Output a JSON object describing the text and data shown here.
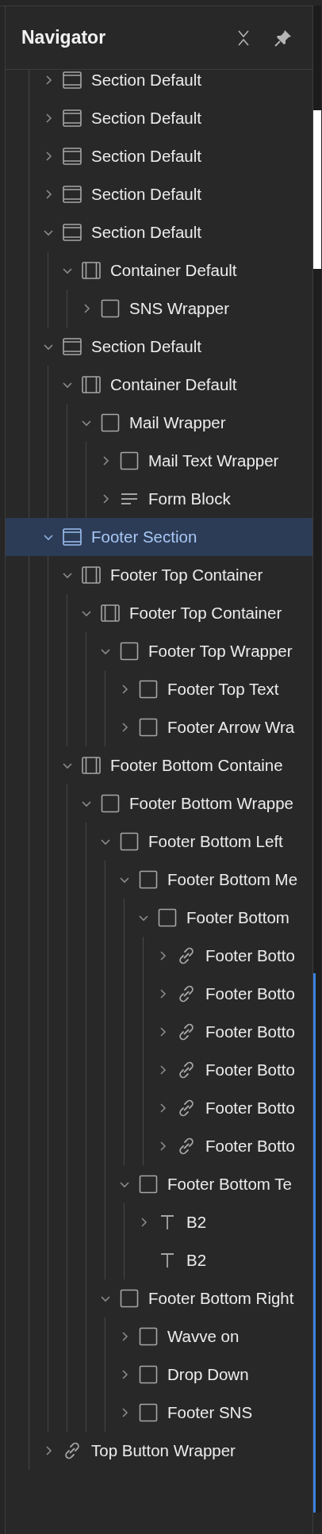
{
  "panel": {
    "title": "Navigator"
  },
  "tree": [
    {
      "label": "Section Default",
      "kind": "section",
      "expanded": false,
      "selected": false
    },
    {
      "label": "Section Default",
      "kind": "section",
      "expanded": false,
      "selected": false
    },
    {
      "label": "Section Default",
      "kind": "section",
      "expanded": false,
      "selected": false
    },
    {
      "label": "Section Default",
      "kind": "section",
      "expanded": false,
      "selected": false
    },
    {
      "label": "Section Default",
      "kind": "section",
      "expanded": true,
      "selected": false,
      "children": [
        {
          "label": "Container Default",
          "kind": "container",
          "expanded": true,
          "selected": false,
          "children": [
            {
              "label": "SNS Wrapper",
              "kind": "div",
              "expanded": false,
              "selected": false
            }
          ]
        }
      ]
    },
    {
      "label": "Section Default",
      "kind": "section",
      "expanded": true,
      "selected": false,
      "children": [
        {
          "label": "Container Default",
          "kind": "container",
          "expanded": true,
          "selected": false,
          "children": [
            {
              "label": "Mail Wrapper",
              "kind": "div",
              "expanded": true,
              "selected": false,
              "children": [
                {
                  "label": "Mail Text Wrapper",
                  "kind": "div",
                  "expanded": false,
                  "selected": false
                },
                {
                  "label": "Form Block",
                  "kind": "form",
                  "expanded": false,
                  "selected": false
                }
              ]
            }
          ]
        }
      ]
    },
    {
      "label": "Footer Section",
      "kind": "section",
      "expanded": true,
      "selected": true,
      "children": [
        {
          "label": "Footer Top Container",
          "kind": "container",
          "expanded": true,
          "selected": false,
          "children": [
            {
              "label": "Footer Top Container",
              "kind": "container",
              "expanded": true,
              "selected": false,
              "children": [
                {
                  "label": "Footer Top Wrapper",
                  "kind": "div",
                  "expanded": true,
                  "selected": false,
                  "children": [
                    {
                      "label": "Footer Top Text",
                      "kind": "div",
                      "expanded": false,
                      "selected": false
                    },
                    {
                      "label": "Footer Arrow Wra",
                      "kind": "div",
                      "expanded": false,
                      "selected": false
                    }
                  ]
                }
              ]
            }
          ]
        },
        {
          "label": "Footer Bottom Containe",
          "kind": "container",
          "expanded": true,
          "selected": false,
          "children": [
            {
              "label": "Footer Bottom Wrappe",
              "kind": "div",
              "expanded": true,
              "selected": false,
              "children": [
                {
                  "label": "Footer Bottom Left",
                  "kind": "div",
                  "expanded": true,
                  "selected": false,
                  "children": [
                    {
                      "label": "Footer Bottom Me",
                      "kind": "div",
                      "expanded": true,
                      "selected": false,
                      "children": [
                        {
                          "label": "Footer Bottom",
                          "kind": "div",
                          "expanded": true,
                          "selected": false,
                          "children": [
                            {
                              "label": "Footer Botto",
                              "kind": "link",
                              "expanded": false,
                              "selected": false
                            },
                            {
                              "label": "Footer Botto",
                              "kind": "link",
                              "expanded": false,
                              "selected": false
                            },
                            {
                              "label": "Footer Botto",
                              "kind": "link",
                              "expanded": false,
                              "selected": false
                            },
                            {
                              "label": "Footer Botto",
                              "kind": "link",
                              "expanded": false,
                              "selected": false
                            },
                            {
                              "label": "Footer Botto",
                              "kind": "link",
                              "expanded": false,
                              "selected": false
                            },
                            {
                              "label": "Footer Botto",
                              "kind": "link",
                              "expanded": false,
                              "selected": false
                            }
                          ]
                        }
                      ]
                    },
                    {
                      "label": "Footer Bottom Te",
                      "kind": "div",
                      "expanded": true,
                      "selected": false,
                      "children": [
                        {
                          "label": "B2",
                          "kind": "text",
                          "expanded": false,
                          "selected": false
                        },
                        {
                          "label": "B2",
                          "kind": "text",
                          "selected": false
                        }
                      ]
                    }
                  ]
                },
                {
                  "label": "Footer Bottom Right",
                  "kind": "div",
                  "expanded": true,
                  "selected": false,
                  "children": [
                    {
                      "label": "Wavve on",
                      "kind": "div",
                      "expanded": false,
                      "selected": false
                    },
                    {
                      "label": "Drop Down",
                      "kind": "div",
                      "expanded": false,
                      "selected": false
                    },
                    {
                      "label": "Footer SNS",
                      "kind": "div",
                      "expanded": false,
                      "selected": false
                    }
                  ]
                }
              ]
            }
          ]
        }
      ]
    },
    {
      "label": "Top Button Wrapper",
      "kind": "link",
      "expanded": false,
      "selected": false
    }
  ]
}
